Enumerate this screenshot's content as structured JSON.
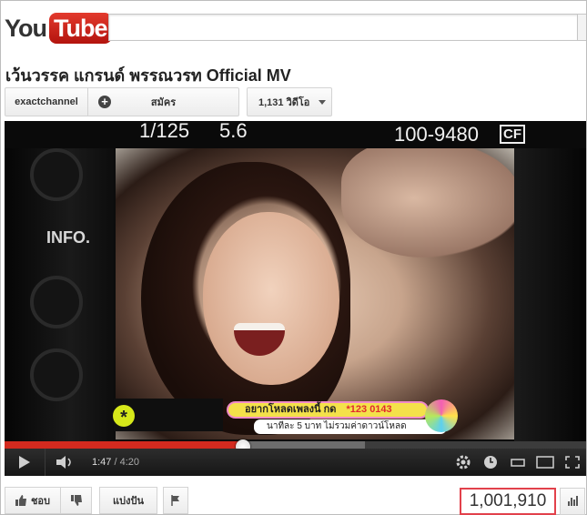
{
  "header": {
    "logo_you": "You",
    "logo_tube": "Tube",
    "search_value": ""
  },
  "video": {
    "title": "เว้นวรรค แกรนด์ พรรณวรท Official MV",
    "channel_name": "exactchannel",
    "subscribe_label": "สมัคร",
    "video_count": "1,131 วิดีโอ",
    "camera_text": {
      "shutter": "1/125",
      "aperture": "5.6",
      "shots": "100-9480",
      "card": "CF",
      "info": "INFO."
    },
    "ad_overlay": {
      "line1": "อยากโหลดเพลงนี้ กด",
      "code": "*123 0143",
      "line2": "นาทีละ 5 บาท ไม่รวมค่าดาวน์โหลด"
    }
  },
  "player": {
    "current_time": "1:47",
    "total_time": "4:20",
    "progress_fraction": 0.411,
    "colors": {
      "played": "#d32a1f",
      "highlight_border": "#e2414b"
    }
  },
  "actions": {
    "like_label": "ชอบ",
    "share_label": "แบ่งปัน",
    "views": "1,001,910",
    "icons": [
      "thumbs-up-icon",
      "thumbs-down-icon",
      "flag-icon",
      "stats-icon"
    ]
  }
}
